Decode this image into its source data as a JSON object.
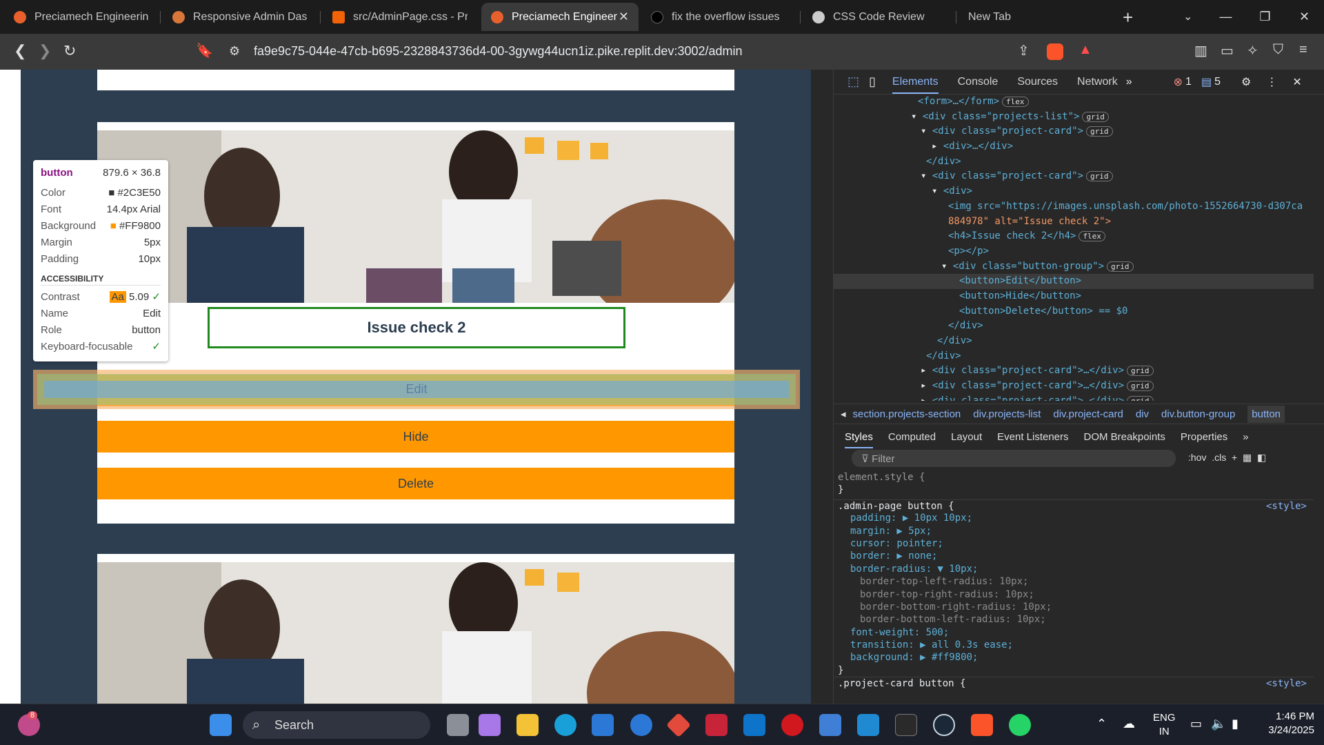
{
  "tabs": [
    {
      "title": "Preciamech Engineering C",
      "color": "#e8602c"
    },
    {
      "title": "Responsive Admin Dashb",
      "color": "#d9773b"
    },
    {
      "title": "src/AdminPage.css - Preci",
      "color": "#f26207"
    },
    {
      "title": "Preciamech Engineer",
      "color": "#e8602c"
    },
    {
      "title": "fix the overflow issues",
      "color": "#000000"
    },
    {
      "title": "CSS Code Review",
      "color": "#cccccc"
    },
    {
      "title": "New Tab",
      "color": ""
    }
  ],
  "tab_close": "✕",
  "address": {
    "url": "fa9e9c75-044e-47cb-b695-2328843736d4-00-3gywg44ucn1iz.pike.replit.dev:3002/admin"
  },
  "page": {
    "card_title": "Issue check 2",
    "buttons": [
      "Edit",
      "Hide",
      "Delete"
    ]
  },
  "tooltip": {
    "tag": "button",
    "size": "879.6 × 36.8",
    "rows": [
      {
        "k": "Color",
        "v": "#2C3E50"
      },
      {
        "k": "Font",
        "v": "14.4px Arial"
      },
      {
        "k": "Background",
        "v": "#FF9800"
      },
      {
        "k": "Margin",
        "v": "5px"
      },
      {
        "k": "Padding",
        "v": "10px"
      }
    ],
    "section": "ACCESSIBILITY",
    "acc": [
      {
        "k": "Contrast",
        "v": "5.09"
      },
      {
        "k": "Name",
        "v": "Edit"
      },
      {
        "k": "Role",
        "v": "button"
      },
      {
        "k": "Keyboard-focusable",
        "v": ""
      }
    ],
    "aa": "Aa"
  },
  "devtools": {
    "tabs": [
      "Elements",
      "Console",
      "Sources",
      "Network"
    ],
    "errors": "1",
    "messages": "5",
    "dom": [
      "<form>…</form>",
      "<div class=\"projects-list\">",
      "<div class=\"project-card\">",
      "<div>…</div>",
      "</div>",
      "<div class=\"project-card\">",
      "<div>",
      "<img src=\"https://images.unsplash.com/photo-1552664730-d307ca",
      "884978\" alt=\"Issue check 2\">",
      "<h4>Issue check 2</h4>",
      "<p></p>",
      "<div class=\"button-group\">",
      "<button>Edit</button>",
      "<button>Hide</button>",
      "<button>Delete</button> == $0",
      "</div>",
      "</div>",
      "</div>",
      "<div class=\"project-card\">…</div>",
      "<div class=\"project-card\">…</div>",
      "<div class=\"project-card\">…</div>"
    ],
    "badges": [
      "flex",
      "grid",
      "grid",
      "grid",
      "flex",
      "grid",
      "grid",
      "grid",
      "grid"
    ],
    "crumbs": [
      "section.projects-section",
      "div.projects-list",
      "div.project-card",
      "div",
      "div.button-group",
      "button"
    ],
    "subtabs": [
      "Styles",
      "Computed",
      "Layout",
      "Event Listeners",
      "DOM Breakpoints",
      "Properties"
    ],
    "filter": "Filter",
    "hov": ":hov",
    "cls": ".cls",
    "styles": [
      "element.style {",
      "}",
      ".admin-page button {",
      "padding: ▶ 10px 10px;",
      "margin: ▶ 5px;",
      "cursor: pointer;",
      "border: ▶ none;",
      "border-radius: ▼ 10px;",
      "border-top-left-radius: 10px;",
      "border-top-right-radius: 10px;",
      "border-bottom-right-radius: 10px;",
      "border-bottom-left-radius: 10px;",
      "font-weight: 500;",
      "transition: ▶ all 0.3s ease;",
      "background: ▶ #ff9800;",
      "}",
      ".project-card button {"
    ],
    "style_source": "<style>"
  },
  "taskbar": {
    "search": "Search",
    "lang": "ENG",
    "region": "IN",
    "time": "1:46 PM",
    "date": "3/24/2025",
    "badge": "8"
  }
}
